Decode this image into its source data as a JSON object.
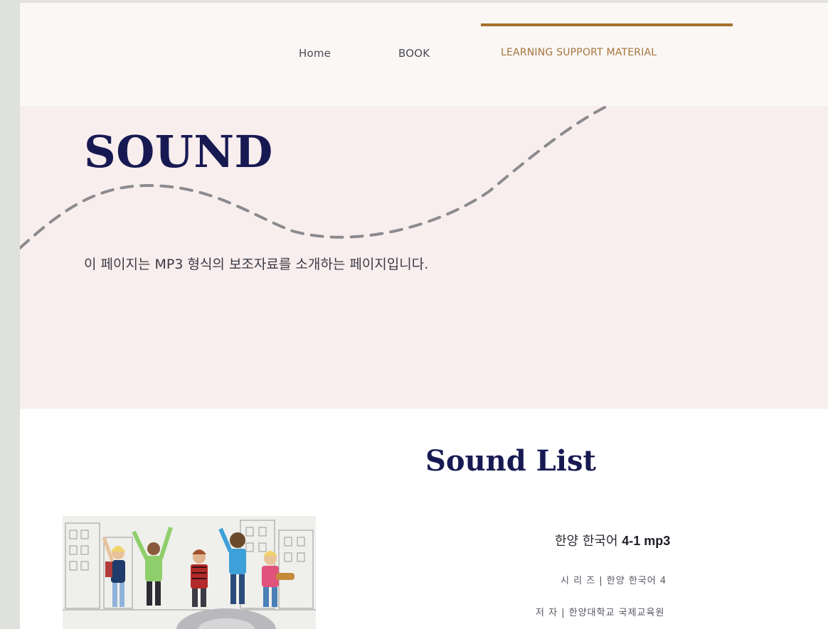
{
  "nav": {
    "items": [
      {
        "label": "Home"
      },
      {
        "label": "BOOK"
      },
      {
        "label": "LEARNING SUPPORT MATERIAL",
        "active": true
      }
    ],
    "active_color": "#a5702f"
  },
  "hero": {
    "title": "SOUND",
    "description": "이 페이지는 MP3 형식의 보조자료를 소개하는 페이지입니다.",
    "background": "#f9eeee"
  },
  "sound_list": {
    "heading": "Sound List",
    "items": [
      {
        "title_prefix": "한양 한국어",
        "title_suffix": "4-1 mp3",
        "series": "시 리 즈 | 한양 한국어 4",
        "author": "저 자  |  한양대학교 국제교육원"
      }
    ]
  },
  "colors": {
    "navy": "#171a52",
    "brand_bronze": "#a5702f",
    "header_bg": "#faf7f5"
  }
}
